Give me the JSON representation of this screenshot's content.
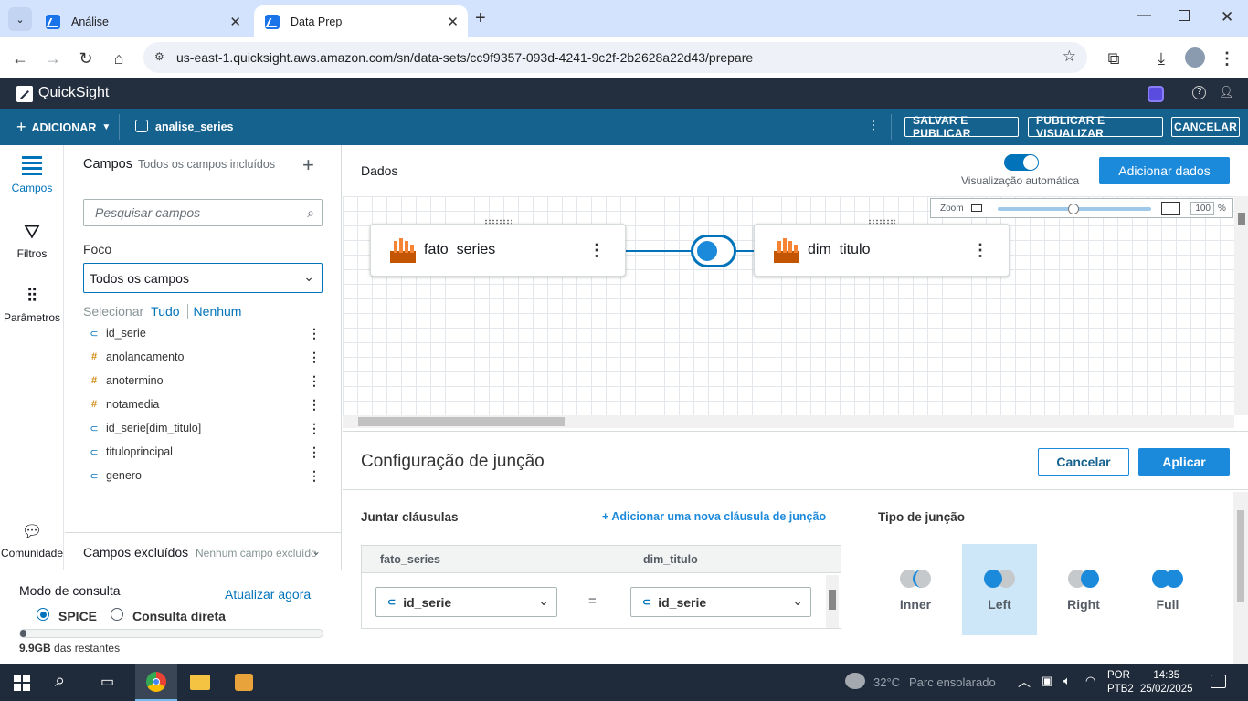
{
  "browser": {
    "tabs": [
      {
        "label": "Análise",
        "active": false
      },
      {
        "label": "Data Prep",
        "active": true
      }
    ],
    "url": "us-east-1.quicksight.aws.amazon.com/sn/data-sets/cc9f9357-093d-4241-9c2f-2b2628a22d43/prepare"
  },
  "app": {
    "name": "QuickSight"
  },
  "toolbar": {
    "add_label": "ADICIONAR",
    "dataset_name": "analise_series",
    "save_publish": "SALVAR E PUBLICAR",
    "publish_view": "PUBLICAR E VISUALIZAR",
    "cancel": "CANCELAR"
  },
  "leftnav": [
    {
      "label": "Campos",
      "icon": "fields-icon",
      "active": true
    },
    {
      "label": "Filtros",
      "icon": "filter-icon"
    },
    {
      "label": "Parâmetros",
      "icon": "parameters-icon"
    },
    {
      "label": "Comunidade",
      "icon": "community-icon"
    }
  ],
  "fields_panel": {
    "title": "Campos",
    "subtitle": "Todos os campos incluídos",
    "search_placeholder": "Pesquisar campos",
    "focus_label": "Foco",
    "focus_value": "Todos os campos",
    "select_label": "Selecionar",
    "select_all": "Tudo",
    "select_none": "Nenhum",
    "fields": [
      {
        "name": "id_serie",
        "type": "string"
      },
      {
        "name": "anolancamento",
        "type": "number"
      },
      {
        "name": "anotermino",
        "type": "number"
      },
      {
        "name": "notamedia",
        "type": "number"
      },
      {
        "name": "id_serie[dim_titulo]",
        "type": "string"
      },
      {
        "name": "tituloprincipal",
        "type": "string"
      },
      {
        "name": "genero",
        "type": "string"
      }
    ],
    "excluded_title": "Campos excluídos",
    "excluded_sub": "Nenhum campo excluído"
  },
  "query_mode": {
    "title": "Modo de consulta",
    "refresh": "Atualizar agora",
    "spice": "SPICE",
    "direct": "Consulta direta",
    "spice_selected": true,
    "capacity": "9.9GB",
    "capacity_suffix": "das restantes"
  },
  "data_area": {
    "title": "Dados",
    "auto_preview": "Visualização automática",
    "add_data": "Adicionar dados",
    "zoom_label": "Zoom",
    "zoom_value": "100",
    "zoom_unit": "%",
    "nodes": [
      {
        "name": "fato_series"
      },
      {
        "name": "dim_titulo"
      }
    ]
  },
  "join_config": {
    "title": "Configuração de junção",
    "cancel": "Cancelar",
    "apply": "Aplicar",
    "clauses_title": "Juntar cláusulas",
    "add_clause": "+ Adicionar uma nova cláusula de junção",
    "left_table": "fato_series",
    "right_table": "dim_titulo",
    "left_field": "id_serie",
    "right_field": "id_serie",
    "equals": "=",
    "join_type_title": "Tipo de junção",
    "types": [
      "Inner",
      "Left",
      "Right",
      "Full"
    ],
    "selected": "Left"
  },
  "taskbar": {
    "weather": "32°C",
    "weather_desc": "Parc ensolarado",
    "lang1": "POR",
    "lang2": "PTB2",
    "time": "14:35",
    "date": "25/02/2025"
  },
  "colors": {
    "accent": "#0073bb",
    "header": "#232f3e",
    "toolbar": "#16628f",
    "selected_bg": "#cde7f8"
  }
}
